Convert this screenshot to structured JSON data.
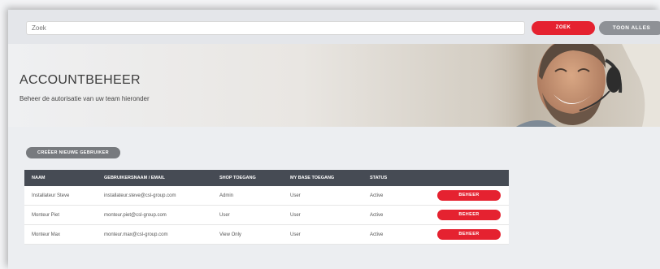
{
  "search": {
    "placeholder": "Zoek",
    "zoek_label": "ZOEK",
    "toon_alles_label": "TOON ALLES"
  },
  "hero": {
    "title": "ACCOUNTBEHEER",
    "subtitle": "Beheer de autorisatie van uw team hieronder"
  },
  "create_button_label": "CREËER NIEUWE GEBRUIKER",
  "table": {
    "headers": [
      "NAAM",
      "GEBRUIKERSNAAM / EMAIL",
      "SHOP TOEGANG",
      "MY BASE TOEGANG",
      "STATUS"
    ],
    "rows": [
      {
        "name": "Installateur Steve",
        "email": "installateur.steve@csl-group.com",
        "shop": "Admin",
        "mybase": "User",
        "status": "Active",
        "action": "BEHEER"
      },
      {
        "name": "Monteur Piet",
        "email": "monteur.piet@csl-group.com",
        "shop": "User",
        "mybase": "User",
        "status": "Active",
        "action": "BEHEER"
      },
      {
        "name": "Monteur Max",
        "email": "monteur.max@csl-group.com",
        "shop": "View Only",
        "mybase": "User",
        "status": "Active",
        "action": "BEHEER"
      }
    ]
  },
  "colors": {
    "accent_red": "#e52230",
    "header_dark": "#464b54",
    "button_grey": "#8e9196"
  }
}
